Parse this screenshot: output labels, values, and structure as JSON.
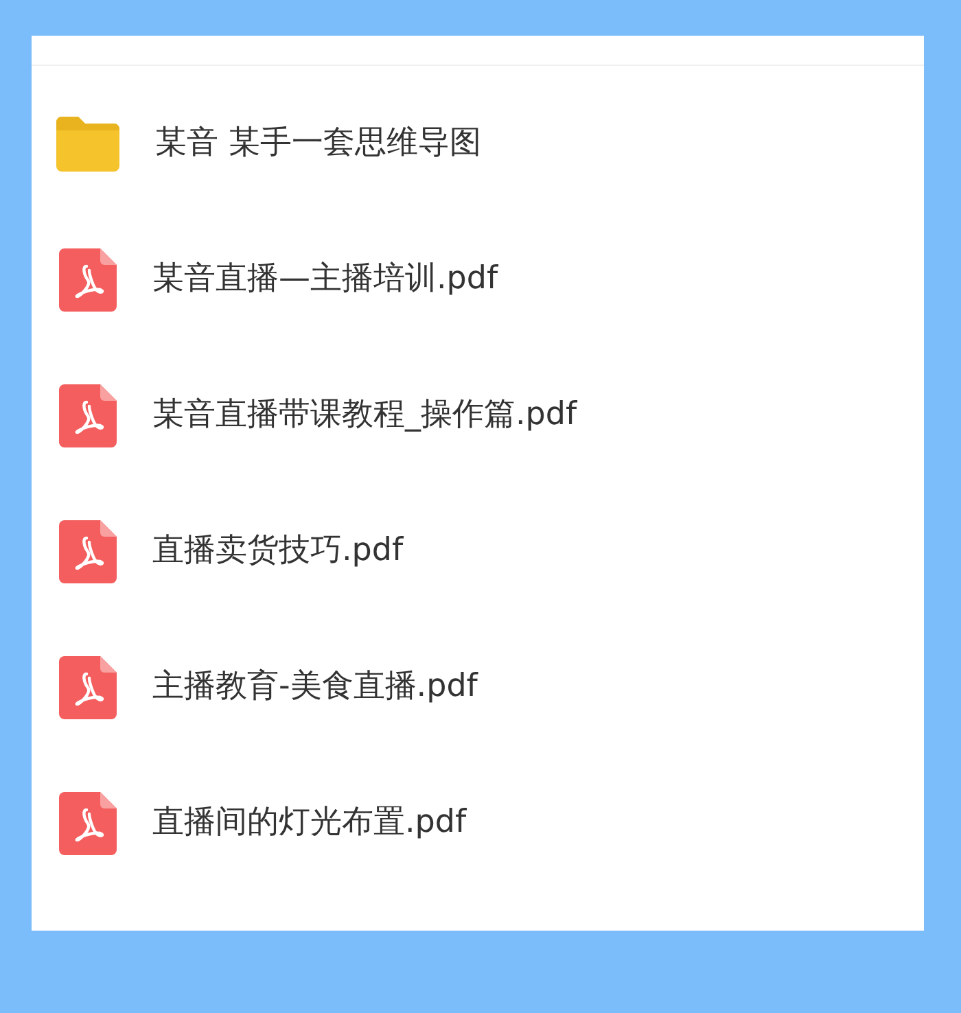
{
  "files": [
    {
      "kind": "folder",
      "name": "某音 某手一套思维导图"
    },
    {
      "kind": "pdf",
      "name": "某音直播—主播培训.pdf"
    },
    {
      "kind": "pdf",
      "name": "某音直播带课教程_操作篇.pdf"
    },
    {
      "kind": "pdf",
      "name": "直播卖货技巧.pdf"
    },
    {
      "kind": "pdf",
      "name": "主播教育-美食直播.pdf"
    },
    {
      "kind": "pdf",
      "name": "直播间的灯光布置.pdf"
    }
  ]
}
